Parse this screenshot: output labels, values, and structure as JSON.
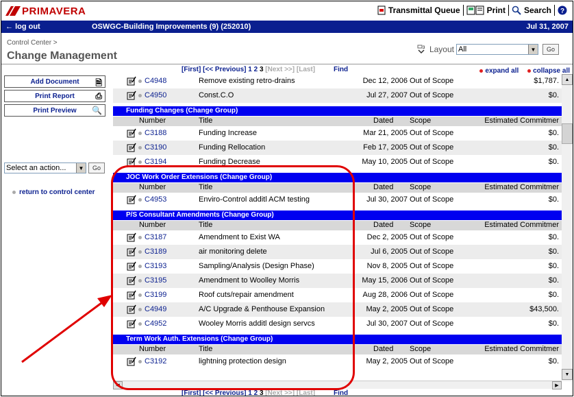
{
  "app": {
    "brand": "PRIMAVERA",
    "tools": {
      "transmittal": "Transmittal Queue",
      "print": "Print",
      "search": "Search"
    },
    "logout": "log out",
    "project": "OSWGC-Building Improvements (9) (252010)",
    "date": "Jul 31, 2007"
  },
  "page": {
    "breadcrumb": "Control Center >",
    "title": "Change Management",
    "layout_label": "Layout",
    "layout_value": "All",
    "go": "Go"
  },
  "sidebar": {
    "add_document": "Add Document",
    "print_report": "Print Report",
    "print_preview": "Print Preview",
    "action_placeholder": "Select an action...",
    "go": "Go",
    "return_link": "return to control center"
  },
  "pager": {
    "first": "[First]",
    "prev": "[<< Previous]",
    "p1": "1",
    "p2": "2",
    "p3": "3",
    "next": "[Next >>]",
    "last": "[Last]",
    "find": "Find"
  },
  "controls": {
    "expand": "expand all",
    "collapse": "collapse all"
  },
  "columns": {
    "number": "Number",
    "title": "Title",
    "dated": "Dated",
    "scope": "Scope",
    "est": "Estimated Commitmer"
  },
  "top_rows": [
    {
      "num": "C4948",
      "title": "Remove existing retro-drains",
      "date": "Dec 12, 2006",
      "scope": "Out of Scope",
      "amt": "$1,787."
    },
    {
      "num": "C4950",
      "title": "Const.C.O",
      "date": "Jul 27, 2007",
      "scope": "Out of Scope",
      "amt": "$0."
    }
  ],
  "groups": [
    {
      "name": "Funding Changes (Change Group)",
      "rows": [
        {
          "num": "C3188",
          "title": "Funding Increase",
          "date": "Mar 21, 2005",
          "scope": "Out of Scope",
          "amt": "$0."
        },
        {
          "num": "C3190",
          "title": "Funding Rellocation",
          "date": "Feb 17, 2005",
          "scope": "Out of Scope",
          "amt": "$0."
        },
        {
          "num": "C3194",
          "title": "Funding Decrease",
          "date": "May 10, 2005",
          "scope": "Out of Scope",
          "amt": "$0."
        }
      ]
    },
    {
      "name": "JOC Work Order Extensions (Change Group)",
      "rows": [
        {
          "num": "C4953",
          "title": "Enviro-Control additl ACM testing",
          "date": "Jul 30, 2007",
          "scope": "Out of Scope",
          "amt": "$0."
        }
      ]
    },
    {
      "name": "P/S Consultant Amendments (Change Group)",
      "rows": [
        {
          "num": "C3187",
          "title": "Amendment to Exist WA",
          "date": "Dec 2, 2005",
          "scope": "Out of Scope",
          "amt": "$0."
        },
        {
          "num": "C3189",
          "title": "air monitoring delete",
          "date": "Jul 6, 2005",
          "scope": "Out of Scope",
          "amt": "$0."
        },
        {
          "num": "C3193",
          "title": "Sampling/Analysis (Design Phase)",
          "date": "Nov 8, 2005",
          "scope": "Out of Scope",
          "amt": "$0."
        },
        {
          "num": "C3195",
          "title": "Amendment to Woolley Morris",
          "date": "May 15, 2006",
          "scope": "Out of Scope",
          "amt": "$0."
        },
        {
          "num": "C3199",
          "title": "Roof cuts/repair amendment",
          "date": "Aug 28, 2006",
          "scope": "Out of Scope",
          "amt": "$0."
        },
        {
          "num": "C4949",
          "title": "A/C Upgrade & Penthouse Expansion",
          "date": "May 2, 2005",
          "scope": "Out of Scope",
          "amt": "$43,500."
        },
        {
          "num": "C4952",
          "title": "Wooley Morris additl design servcs",
          "date": "Jul 30, 2007",
          "scope": "Out of Scope",
          "amt": "$0."
        }
      ]
    },
    {
      "name": "Term Work Auth. Extensions (Change Group)",
      "rows": [
        {
          "num": "C3192",
          "title": "lightning protection design",
          "date": "May 2, 2005",
          "scope": "Out of Scope",
          "amt": "$0."
        }
      ]
    }
  ],
  "colors": {
    "brand_red": "#c00000",
    "nav_blue": "#0a1f8f",
    "group_blue": "#0000f0",
    "callout_red": "#e00000"
  }
}
